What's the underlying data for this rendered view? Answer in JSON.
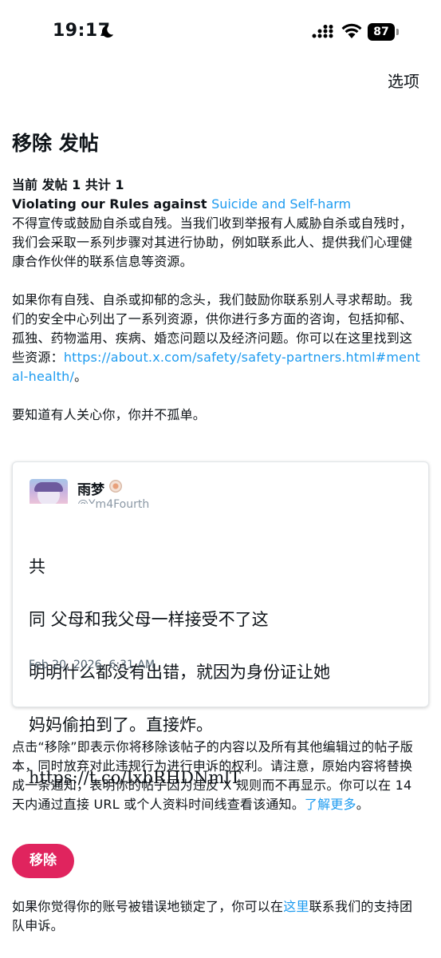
{
  "status_bar": {
    "time": "19:17",
    "battery": "87"
  },
  "header": {
    "options_label": "选项"
  },
  "title": "移除 发帖",
  "counter": "当前 发帖 1 共计 1",
  "rule": {
    "prefix": "Violating our Rules against ",
    "link": "Suicide and Self-harm",
    "text": "不得宣传或鼓励自杀或自残。当我们收到举报有人威胁自杀或自残时，我们会采取一系列步骤对其进行协助，例如联系此人、提供我们心理健康合作伙伴的联系信息等资源。"
  },
  "resources": {
    "text": "如果你有自残、自杀或抑郁的念头，我们鼓励你联系别人寻求帮助。我们的安全中心列出了一系列资源，供你进行多方面的咨询，包括抑郁、孤独、药物滥用、疾病、婚恋问题以及经济问题。你可以在这里找到这些资源：",
    "link": "https://about.x.com/safety/safety-partners.html#mental-health/",
    "suffix": "。"
  },
  "reassurance": "要知道有人关心你，你并不孤单。",
  "tweet": {
    "display_name": "雨梦",
    "handle": "@Ym4Fourth",
    "line1": "共",
    "line2": "同   父母和我父母一样接受不了这",
    "line3": "  明明什么都没有出错，就因为身份证让她",
    "line4": "妈妈偷拍到了。直接炸。",
    "line5": "https://t.co/IxbRHDNmlT",
    "date": "Feb 20, 2026, 6:31 AM"
  },
  "notice": {
    "text": "点击“移除”即表示你将移除该帖子的内容以及所有其他编辑过的帖子版本，同时放弃对此违规行为进行申诉的权利。请注意，原始内容将替换成一条通知，表明你的帖子因为违反 X 规则而不再显示。你可以在 14 天内通过直接 URL 或个人资料时间线查看该通知。",
    "link": "了解更多",
    "suffix": "。"
  },
  "remove_button": "移除",
  "appeal": {
    "prefix": "如果你觉得你的账号被错误地锁定了，你可以在",
    "link": "这里",
    "suffix": "联系我们的支持团队申诉。"
  },
  "colors": {
    "link": "#1d9bf0",
    "remove_button": "#e0245e"
  }
}
